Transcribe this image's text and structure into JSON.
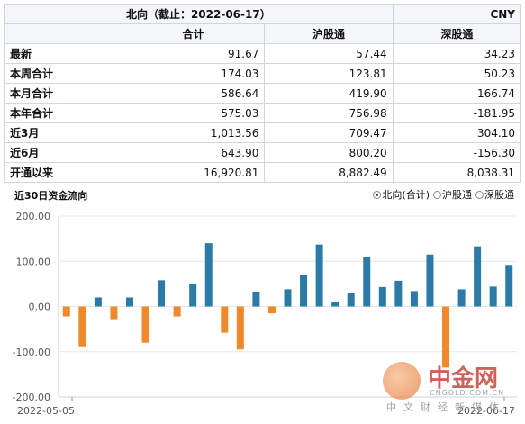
{
  "summary": {
    "title": "北向（截止：2022-06-17）",
    "currency": "CNY",
    "columns": [
      "合计",
      "沪股通",
      "深股通"
    ],
    "rows": [
      {
        "label": "最新",
        "total": "91.67",
        "sh": "57.44",
        "sz": "34.23"
      },
      {
        "label": "本周合计",
        "total": "174.03",
        "sh": "123.81",
        "sz": "50.23"
      },
      {
        "label": "本月合计",
        "total": "586.64",
        "sh": "419.90",
        "sz": "166.74"
      },
      {
        "label": "本年合计",
        "total": "575.03",
        "sh": "756.98",
        "sz": "-181.95"
      },
      {
        "label": "近3月",
        "total": "1,013.56",
        "sh": "709.47",
        "sz": "304.10"
      },
      {
        "label": "近6月",
        "total": "643.90",
        "sh": "800.20",
        "sz": "-156.30"
      },
      {
        "label": "开通以来",
        "total": "16,920.81",
        "sh": "8,882.49",
        "sz": "8,038.31"
      }
    ]
  },
  "chart_header": {
    "title": "近30日资金流向",
    "legend": [
      {
        "label": "北向(合计)",
        "selected": true
      },
      {
        "label": "沪股通",
        "selected": false
      },
      {
        "label": "深股通",
        "selected": false
      }
    ]
  },
  "chart_data": {
    "type": "bar",
    "title": "近30日资金流向",
    "ylim": [
      -200,
      200
    ],
    "yticks": [
      "200.00",
      "100.00",
      "0.00",
      "-100.00",
      "-200.00"
    ],
    "x_tick_labels": [
      "2022-05-05",
      "2022-06-17"
    ],
    "grid": true,
    "positive_color": "#2b7ba6",
    "negative_color": "#f0892b",
    "values": [
      -22,
      -88,
      20,
      -28,
      20,
      -80,
      58,
      -22,
      50,
      140,
      -58,
      -95,
      33,
      -15,
      38,
      70,
      137,
      10,
      30,
      110,
      43,
      57,
      34,
      115,
      -135,
      38,
      133,
      44,
      92
    ]
  },
  "watermark": {
    "name": "中金网",
    "domain": "CNGOLD.COM.CN",
    "tagline": "中文财经新媒体"
  }
}
